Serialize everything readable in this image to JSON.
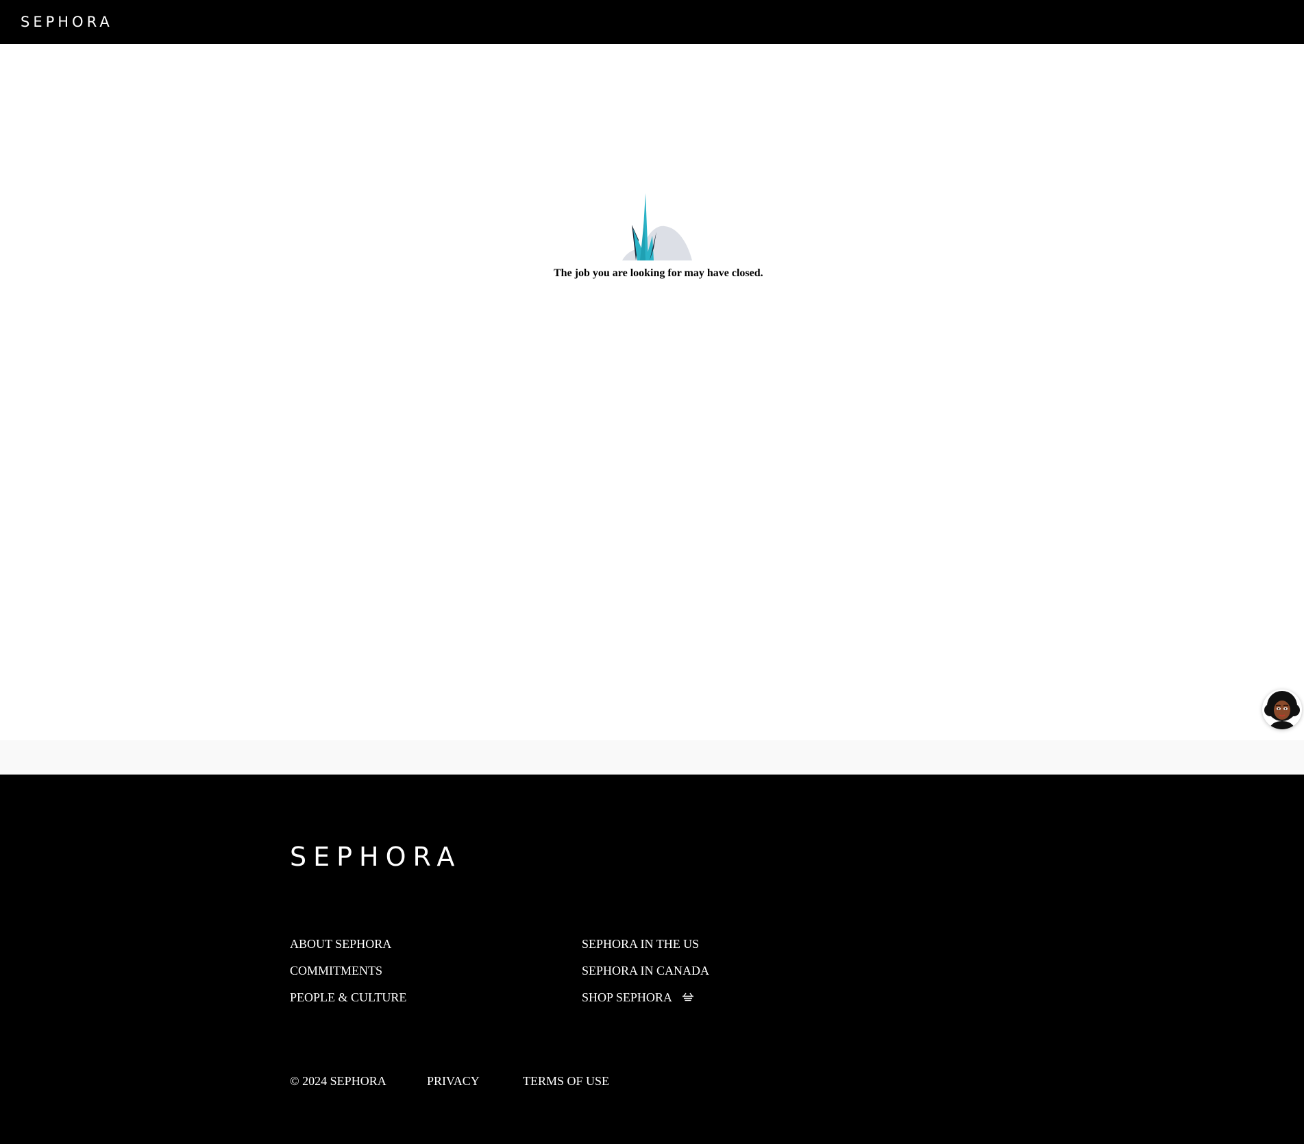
{
  "header": {
    "logo": "SEPHORA"
  },
  "main": {
    "message": "The job you are looking for may have closed.",
    "illustration_icon": "grass-on-hill-illustration"
  },
  "chat": {
    "icon": "chat-assistant-avatar"
  },
  "footer": {
    "logo": "SEPHORA",
    "left_links": [
      "ABOUT SEPHORA",
      "COMMITMENTS",
      "PEOPLE & CULTURE"
    ],
    "right_links": [
      "SEPHORA IN THE US",
      "SEPHORA IN CANADA",
      "SHOP SEPHORA"
    ],
    "shop_icon": "basket-icon",
    "copyright": "© 2024 SEPHORA",
    "privacy": "PRIVACY",
    "terms": "TERMS OF USE"
  },
  "colors": {
    "header_bg": "#000000",
    "footer_bg": "#000000",
    "band_bg": "#f9f9f9",
    "grass_teal": "#2bb3c7",
    "hill_grey": "#dcdfe6"
  }
}
